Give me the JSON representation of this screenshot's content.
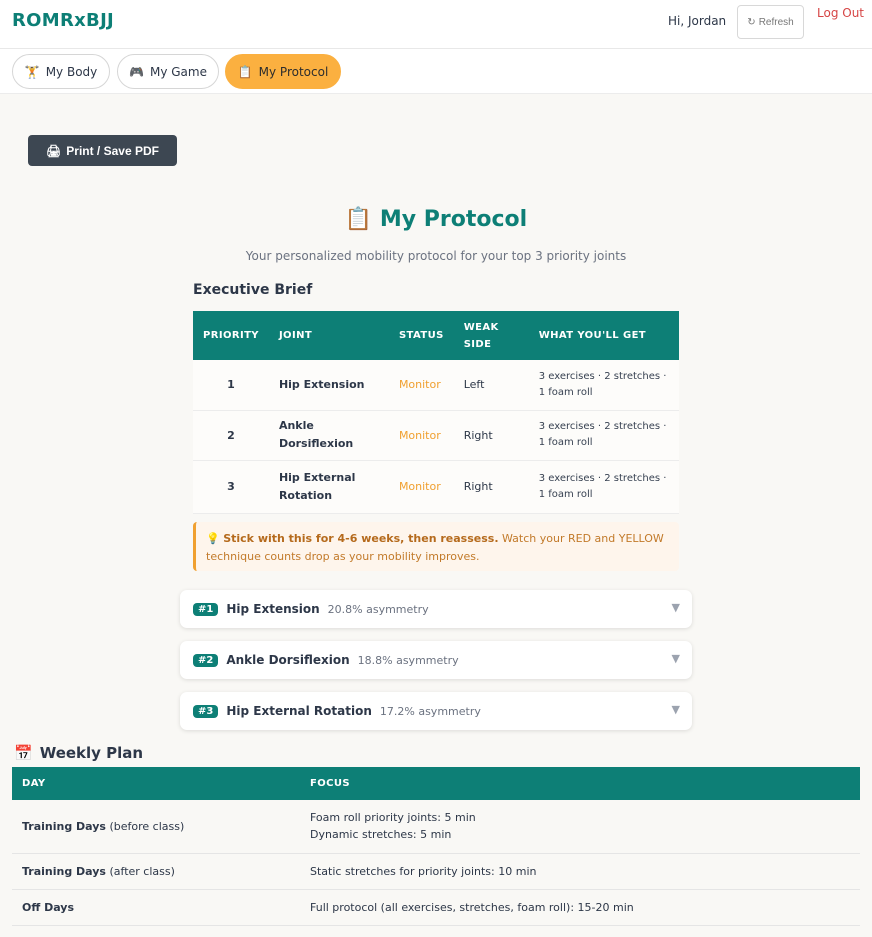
{
  "header": {
    "brand": "ROMRxBJJ",
    "greeting": "Hi, Jordan",
    "refresh_icon": "↻",
    "refresh_label": "Refresh",
    "logout_label": "Log Out"
  },
  "tabs": [
    {
      "icon": "🏋",
      "label": "My Body"
    },
    {
      "icon": "🎮",
      "label": "My Game"
    },
    {
      "icon": "📋",
      "label": "My Protocol"
    }
  ],
  "print": {
    "icon": "🖨",
    "label": "Print / Save PDF"
  },
  "page": {
    "title_icon": "📋",
    "title": "My Protocol",
    "subtitle": "Your personalized mobility protocol for your top 3 priority joints"
  },
  "executive_brief": {
    "heading": "Executive Brief",
    "columns": [
      "PRIORITY",
      "JOINT",
      "STATUS",
      "WEAK SIDE",
      "WHAT YOU'LL GET"
    ],
    "rows": [
      {
        "priority": "1",
        "joint": "Hip Extension",
        "status": "Monitor",
        "weak_side": "Left",
        "get": "3 exercises · 2 stretches · 1 foam roll"
      },
      {
        "priority": "2",
        "joint": "Ankle Dorsiflexion",
        "status": "Monitor",
        "weak_side": "Right",
        "get": "3 exercises · 2 stretches · 1 foam roll"
      },
      {
        "priority": "3",
        "joint": "Hip External Rotation",
        "status": "Monitor",
        "weak_side": "Right",
        "get": "3 exercises · 2 stretches · 1 foam roll"
      }
    ],
    "tip_icon": "💡",
    "tip_bold": "Stick with this for 4-6 weeks, then reassess.",
    "tip_text": " Watch your RED and YELLOW technique counts drop as your mobility improves."
  },
  "joint_cards": [
    {
      "badge": "#1",
      "name": "Hip Extension",
      "asymmetry": "20.8% asymmetry"
    },
    {
      "badge": "#2",
      "name": "Ankle Dorsiflexion",
      "asymmetry": "18.8% asymmetry"
    },
    {
      "badge": "#3",
      "name": "Hip External Rotation",
      "asymmetry": "17.2% asymmetry"
    }
  ],
  "chevron_icon": "▼",
  "weekly_plan": {
    "heading_icon": "📅",
    "heading": "Weekly Plan",
    "columns": [
      "DAY",
      "FOCUS"
    ],
    "rows": [
      {
        "day": "Training Days",
        "day_note": " (before class)",
        "focus_lines": [
          "Foam roll priority joints: 5 min",
          "Dynamic stretches: 5 min"
        ]
      },
      {
        "day": "Training Days",
        "day_note": " (after class)",
        "focus_lines": [
          "Static stretches for priority joints: 10 min"
        ]
      },
      {
        "day": "Off Days",
        "day_note": "",
        "focus_lines": [
          "Full protocol (all exercises, stretches, foam roll): 15-20 min"
        ]
      }
    ]
  },
  "colors": {
    "brand": "#0d7f76",
    "accent": "#fbb040",
    "status_monitor": "#f0a030",
    "logout": "#d64545"
  }
}
